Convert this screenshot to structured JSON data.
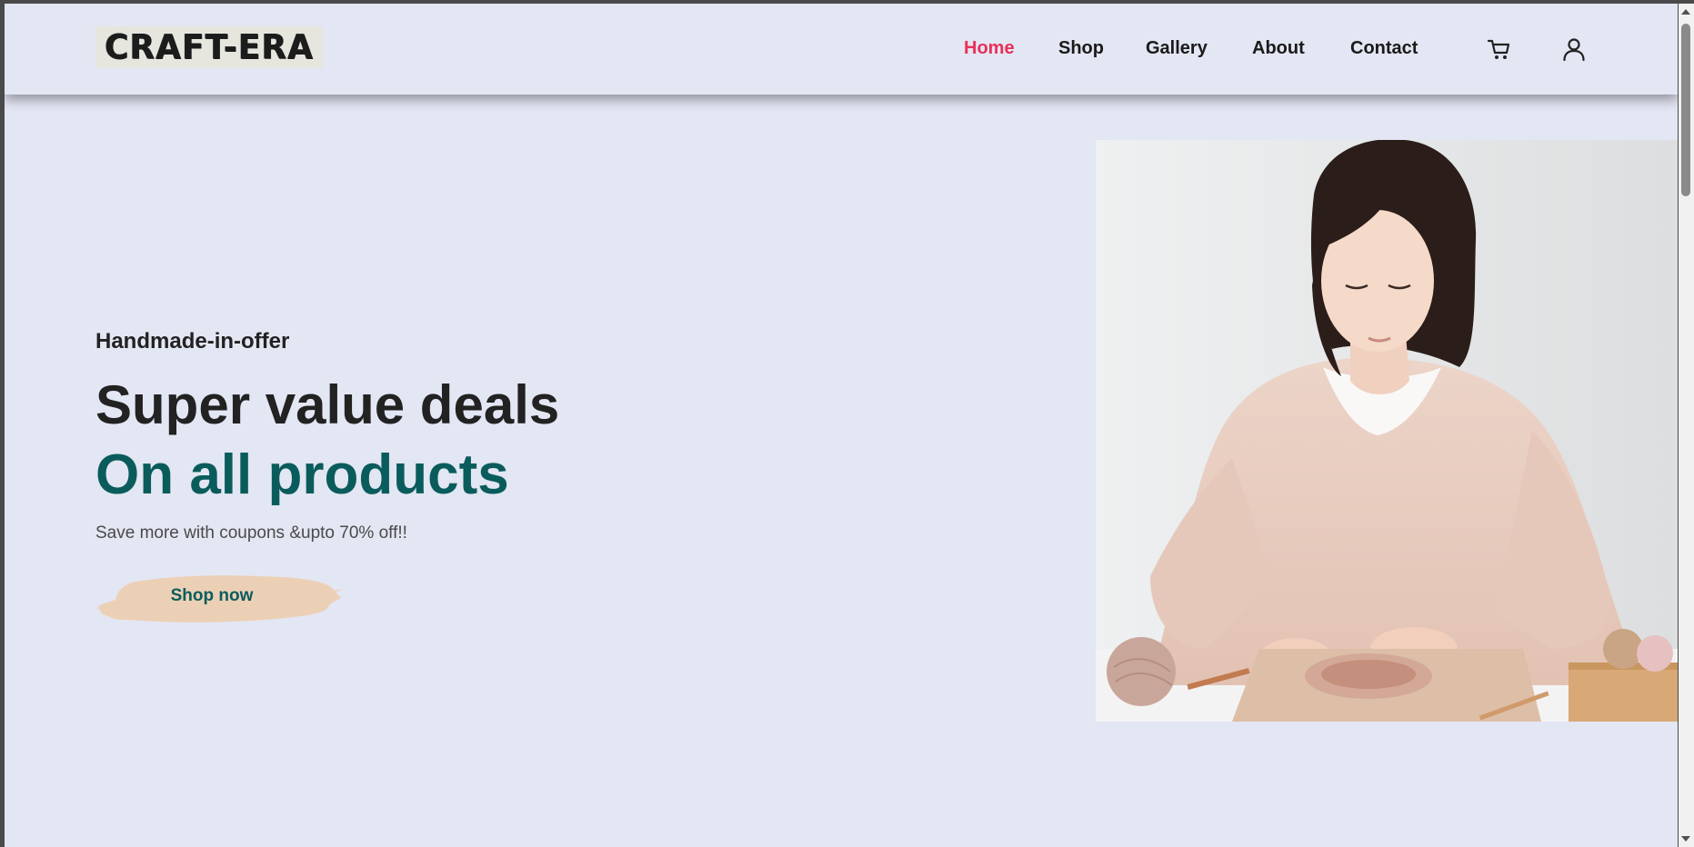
{
  "brand": {
    "logo_text": "CRAFT-ERA"
  },
  "nav": {
    "items": [
      {
        "label": "Home",
        "active": true
      },
      {
        "label": "Shop",
        "active": false
      },
      {
        "label": "Gallery",
        "active": false
      },
      {
        "label": "About",
        "active": false
      },
      {
        "label": "Contact",
        "active": false
      }
    ],
    "icons": [
      "cart-icon",
      "user-icon"
    ]
  },
  "hero": {
    "kicker": "Handmade-in-offer",
    "headline": "Super value deals",
    "subheadline": "On all products",
    "description": "Save more with coupons &upto 70% off!!",
    "cta_label": "Shop now"
  },
  "colors": {
    "background": "#e3e6f3",
    "accent_active": "#e8305a",
    "teal": "#0a5c5c",
    "button_brush": "#ecd0b6"
  }
}
